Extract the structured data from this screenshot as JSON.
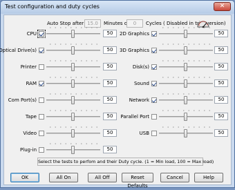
{
  "window": {
    "title": "Test configuration and duty cycles",
    "close_label": "✕"
  },
  "autostop": {
    "label_before": "Auto Stop after",
    "minutes_value": "15.0",
    "label_minutes": "Minutes or",
    "cycles_value": "0",
    "label_cycles": "Cycles ( Disabled in trial version)",
    "icon": "gauge-icon"
  },
  "left_tests": [
    {
      "label": "CPU",
      "checked": true,
      "focused": true,
      "value": "50"
    },
    {
      "label": "Optical Drive(s)",
      "checked": true,
      "value": "50"
    },
    {
      "label": "Printer",
      "checked": false,
      "value": "50"
    },
    {
      "label": "RAM",
      "checked": true,
      "value": "50"
    },
    {
      "label": "Com Port(s)",
      "checked": false,
      "value": "50"
    },
    {
      "label": "Tape",
      "checked": false,
      "value": "50"
    },
    {
      "label": "Video",
      "checked": false,
      "value": "50"
    },
    {
      "label": "Plug-in",
      "checked": false,
      "value": "50"
    }
  ],
  "right_tests": [
    {
      "label": "2D Graphics",
      "checked": true,
      "value": "50"
    },
    {
      "label": "3D Graphics",
      "checked": true,
      "value": "50"
    },
    {
      "label": "Disk(s)",
      "checked": true,
      "value": "50"
    },
    {
      "label": "Sound",
      "checked": true,
      "value": "50"
    },
    {
      "label": "Network",
      "checked": true,
      "value": "50"
    },
    {
      "label": "Parallel Port",
      "checked": false,
      "value": "50"
    },
    {
      "label": "USB",
      "checked": false,
      "value": "50"
    }
  ],
  "hint": "Select the tests to perfom and their Duty cycle. (1 = Min load, 100 = Max load)",
  "buttons": {
    "ok": "OK",
    "all_on": "All On",
    "all_off": "All Off",
    "reset_defaults": "Reset Defaults",
    "cancel": "Cancel",
    "help": "Help"
  }
}
